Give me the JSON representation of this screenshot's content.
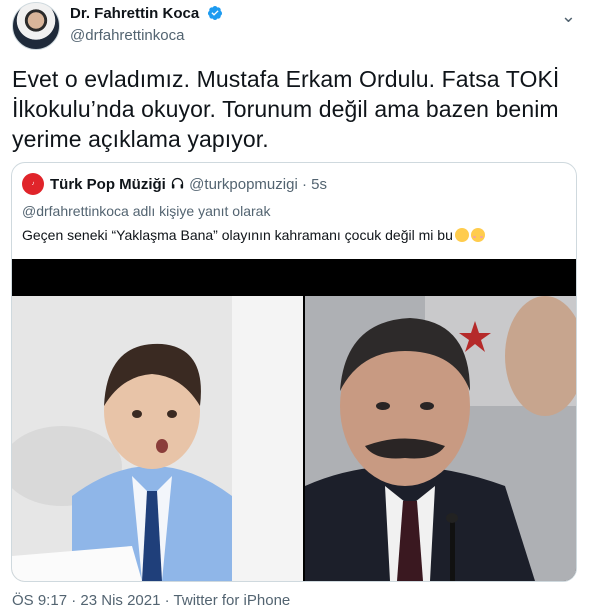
{
  "author": {
    "name": "Dr. Fahrettin Koca",
    "handle": "@drfahrettinkoca"
  },
  "tweet": {
    "text_lines": [
      "Evet o evladımız. Mustafa Erkam Ordulu. Fatsa TOKİ",
      "İlkokulu’nda okuyor. Torunum değil ama bazen benim",
      "yerime açıklama yapıyor."
    ]
  },
  "quoted_tweet": {
    "name": "Türk Pop Müziği",
    "handle": "@turkpopmuzigi",
    "separator": "·",
    "time": "5s",
    "reply_context": "@drfahrettinkoca adlı kişiye yanıt olarak",
    "text": "Geçen seneki “Yaklaşma Bana” olayının kahramanı çocuk değil mi bu"
  },
  "footer": {
    "time": "ÖS 9:17",
    "separator": "·",
    "date": "23 Nis 2021",
    "source": "Twitter for iPhone"
  },
  "colors": {
    "verified": "#1d9bf0",
    "secondary_text": "#536471",
    "border": "#cfd9de"
  },
  "icons": [
    "verified-badge-icon",
    "more-options-icon",
    "headphones-icon",
    "grinning-emoji-icon",
    "blush-emoji-icon"
  ]
}
